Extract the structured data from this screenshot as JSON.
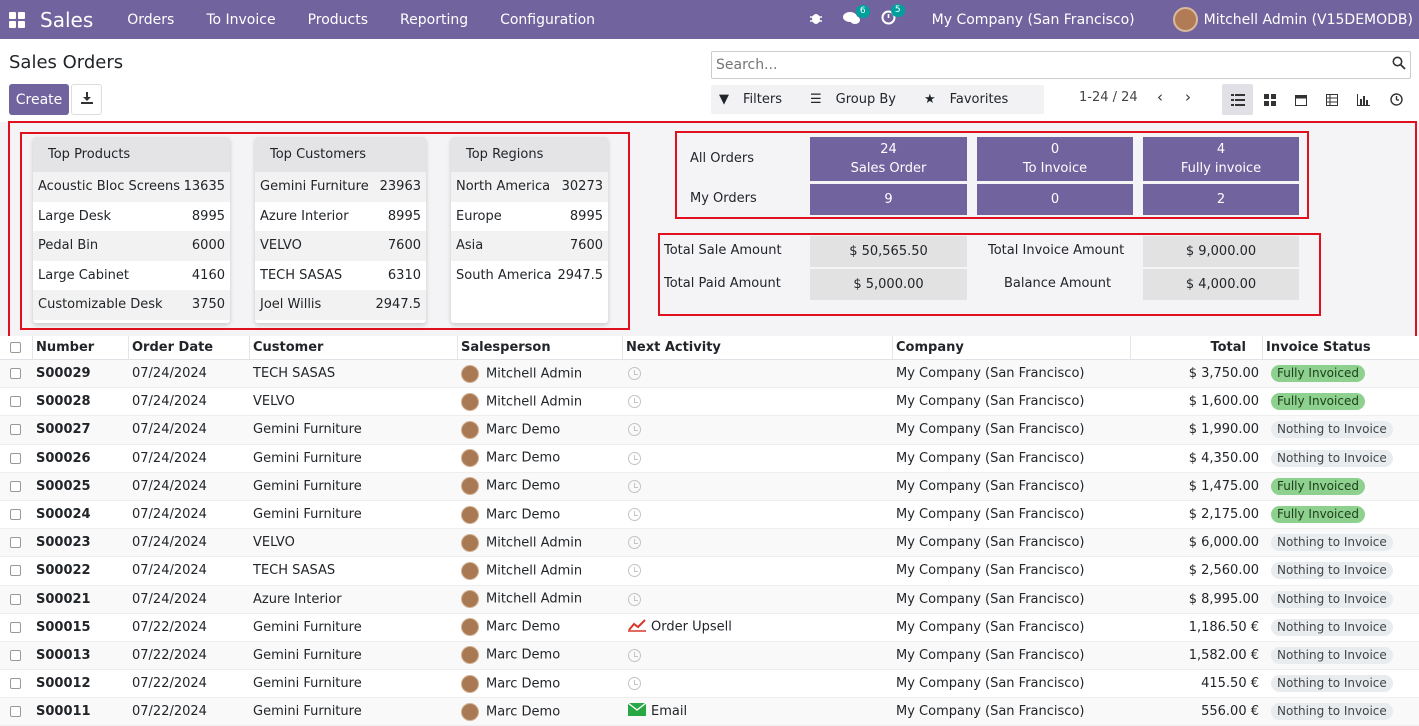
{
  "topnav": {
    "brand": "Sales",
    "menu": [
      "Orders",
      "To Invoice",
      "Products",
      "Reporting",
      "Configuration"
    ],
    "messages_count": "6",
    "activities_count": "5",
    "company": "My Company (San Francisco)",
    "user": "Mitchell Admin (V15DEMODB)"
  },
  "control": {
    "title": "Sales Orders",
    "create_label": "Create",
    "search_placeholder": "Search...",
    "filters_label": "Filters",
    "groupby_label": "Group By",
    "favorites_label": "Favorites",
    "pager": "1-24 / 24"
  },
  "dashboard": {
    "top_products": {
      "title": "Top Products",
      "rows": [
        {
          "name": "Acoustic Bloc Screens",
          "value": "13635"
        },
        {
          "name": "Large Desk",
          "value": "8995"
        },
        {
          "name": "Pedal Bin",
          "value": "6000"
        },
        {
          "name": "Large Cabinet",
          "value": "4160"
        },
        {
          "name": "Customizable Desk",
          "value": "3750"
        }
      ]
    },
    "top_customers": {
      "title": "Top Customers",
      "rows": [
        {
          "name": "Gemini Furniture",
          "value": "23963"
        },
        {
          "name": "Azure Interior",
          "value": "8995"
        },
        {
          "name": "VELVO",
          "value": "7600"
        },
        {
          "name": "TECH SASAS",
          "value": "6310"
        },
        {
          "name": "Joel Willis",
          "value": "2947.5"
        }
      ]
    },
    "top_regions": {
      "title": "Top Regions",
      "rows": [
        {
          "name": "North America",
          "value": "30273"
        },
        {
          "name": "Europe",
          "value": "8995"
        },
        {
          "name": "Asia",
          "value": "7600"
        },
        {
          "name": "South America",
          "value": "2947.5"
        }
      ]
    },
    "orders": {
      "all_label": "All Orders",
      "my_label": "My Orders",
      "sales_count": "24",
      "sales_label": "Sales Order",
      "to_invoice_count": "0",
      "to_invoice_label": "To Invoice",
      "fully_count": "4",
      "fully_label": "Fully invoice",
      "my_sales": "9",
      "my_to_invoice": "0",
      "my_fully": "2"
    },
    "amounts": {
      "total_sale_label": "Total Sale Amount",
      "total_sale": "$ 50,565.50",
      "total_invoice_label": "Total Invoice Amount",
      "total_invoice": "$ 9,000.00",
      "total_paid_label": "Total Paid Amount",
      "total_paid": "$ 5,000.00",
      "balance_label": "Balance Amount",
      "balance": "$ 4,000.00"
    }
  },
  "table": {
    "headers": [
      "Number",
      "Order Date",
      "Customer",
      "Salesperson",
      "Next Activity",
      "Company",
      "Total",
      "Invoice Status"
    ],
    "rows": [
      {
        "number": "S00029",
        "date": "07/24/2024",
        "customer": "TECH SASAS",
        "salesperson": "Mitchell Admin",
        "activity": "",
        "activity_icon": "clock-icon",
        "company": "My Company (San Francisco)",
        "total": "$ 3,750.00",
        "status": "Fully Invoiced",
        "status_color": "#8ed08e"
      },
      {
        "number": "S00028",
        "date": "07/24/2024",
        "customer": "VELVO",
        "salesperson": "Mitchell Admin",
        "activity": "",
        "activity_icon": "clock-icon",
        "company": "My Company (San Francisco)",
        "total": "$ 1,600.00",
        "status": "Fully Invoiced",
        "status_color": "#8ed08e"
      },
      {
        "number": "S00027",
        "date": "07/24/2024",
        "customer": "Gemini Furniture",
        "salesperson": "Marc Demo",
        "activity": "",
        "activity_icon": "clock-icon",
        "company": "My Company (San Francisco)",
        "total": "$ 1,990.00",
        "status": "Nothing to Invoice",
        "status_color": "#e9ecef"
      },
      {
        "number": "S00026",
        "date": "07/24/2024",
        "customer": "Gemini Furniture",
        "salesperson": "Marc Demo",
        "activity": "",
        "activity_icon": "clock-icon",
        "company": "My Company (San Francisco)",
        "total": "$ 4,350.00",
        "status": "Nothing to Invoice",
        "status_color": "#e9ecef"
      },
      {
        "number": "S00025",
        "date": "07/24/2024",
        "customer": "Gemini Furniture",
        "salesperson": "Marc Demo",
        "activity": "",
        "activity_icon": "clock-icon",
        "company": "My Company (San Francisco)",
        "total": "$ 1,475.00",
        "status": "Fully Invoiced",
        "status_color": "#8ed08e"
      },
      {
        "number": "S00024",
        "date": "07/24/2024",
        "customer": "Gemini Furniture",
        "salesperson": "Marc Demo",
        "activity": "",
        "activity_icon": "clock-icon",
        "company": "My Company (San Francisco)",
        "total": "$ 2,175.00",
        "status": "Fully Invoiced",
        "status_color": "#8ed08e"
      },
      {
        "number": "S00023",
        "date": "07/24/2024",
        "customer": "VELVO",
        "salesperson": "Mitchell Admin",
        "activity": "",
        "activity_icon": "clock-icon",
        "company": "My Company (San Francisco)",
        "total": "$ 6,000.00",
        "status": "Nothing to Invoice",
        "status_color": "#e9ecef"
      },
      {
        "number": "S00022",
        "date": "07/24/2024",
        "customer": "TECH SASAS",
        "salesperson": "Mitchell Admin",
        "activity": "",
        "activity_icon": "clock-icon",
        "company": "My Company (San Francisco)",
        "total": "$ 2,560.00",
        "status": "Nothing to Invoice",
        "status_color": "#e9ecef"
      },
      {
        "number": "S00021",
        "date": "07/24/2024",
        "customer": "Azure Interior",
        "salesperson": "Mitchell Admin",
        "activity": "",
        "activity_icon": "clock-icon",
        "company": "My Company (San Francisco)",
        "total": "$ 8,995.00",
        "status": "Nothing to Invoice",
        "status_color": "#e9ecef"
      },
      {
        "number": "S00015",
        "date": "07/22/2024",
        "customer": "Gemini Furniture",
        "salesperson": "Marc Demo",
        "activity": "Order Upsell",
        "activity_icon": "chart-line-icon",
        "company": "My Company (San Francisco)",
        "total": "1,186.50 €",
        "status": "Nothing to Invoice",
        "status_color": "#e9ecef"
      },
      {
        "number": "S00013",
        "date": "07/22/2024",
        "customer": "Gemini Furniture",
        "salesperson": "Marc Demo",
        "activity": "",
        "activity_icon": "clock-icon",
        "company": "My Company (San Francisco)",
        "total": "1,582.00 €",
        "status": "Nothing to Invoice",
        "status_color": "#e9ecef"
      },
      {
        "number": "S00012",
        "date": "07/22/2024",
        "customer": "Gemini Furniture",
        "salesperson": "Marc Demo",
        "activity": "",
        "activity_icon": "clock-icon",
        "company": "My Company (San Francisco)",
        "total": "415.50 €",
        "status": "Nothing to Invoice",
        "status_color": "#e9ecef"
      },
      {
        "number": "S00011",
        "date": "07/22/2024",
        "customer": "Gemini Furniture",
        "salesperson": "Marc Demo",
        "activity": "Email",
        "activity_icon": "envelope-icon",
        "company": "My Company (San Francisco)",
        "total": "556.00 €",
        "status": "Nothing to Invoice",
        "status_color": "#e9ecef"
      }
    ]
  },
  "colors": {
    "brand": "#71639e",
    "highlight": "#e0101e",
    "fully_invoiced": "#8ed08e",
    "nothing_to_invoice": "#e9ecef"
  }
}
